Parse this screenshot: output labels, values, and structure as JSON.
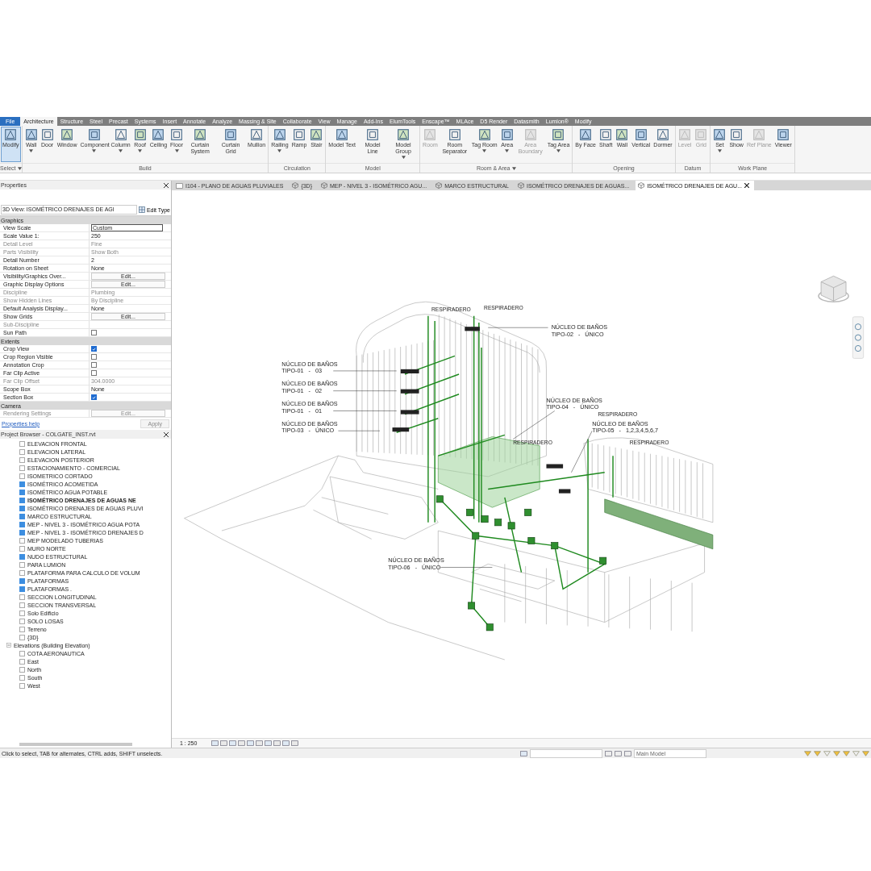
{
  "menu_tabs": [
    {
      "label": "File",
      "kind": "file",
      "selected": false
    },
    {
      "label": "Architecture",
      "kind": "tab",
      "selected": true
    },
    {
      "label": "Structure",
      "kind": "tab",
      "selected": false
    },
    {
      "label": "Steel",
      "kind": "tab",
      "selected": false
    },
    {
      "label": "Precast",
      "kind": "tab",
      "selected": false
    },
    {
      "label": "Systems",
      "kind": "tab",
      "selected": false
    },
    {
      "label": "Insert",
      "kind": "tab",
      "selected": false
    },
    {
      "label": "Annotate",
      "kind": "tab",
      "selected": false
    },
    {
      "label": "Analyze",
      "kind": "tab",
      "selected": false
    },
    {
      "label": "Massing & Site",
      "kind": "tab",
      "selected": false
    },
    {
      "label": "Collaborate",
      "kind": "tab",
      "selected": false
    },
    {
      "label": "View",
      "kind": "tab",
      "selected": false
    },
    {
      "label": "Manage",
      "kind": "tab",
      "selected": false
    },
    {
      "label": "Add-Ins",
      "kind": "tab",
      "selected": false
    },
    {
      "label": "ElumTools",
      "kind": "tab",
      "selected": false
    },
    {
      "label": "Enscape™",
      "kind": "tab",
      "selected": false
    },
    {
      "label": "MLAce",
      "kind": "tab",
      "selected": false
    },
    {
      "label": "D5 Render",
      "kind": "tab",
      "selected": false
    },
    {
      "label": "Datasmith",
      "kind": "tab",
      "selected": false
    },
    {
      "label": "Lumion®",
      "kind": "tab",
      "selected": false
    },
    {
      "label": "Modify",
      "kind": "tab",
      "selected": false
    }
  ],
  "ribbon": {
    "panels": [
      {
        "title": "Select",
        "menu": true,
        "tools": [
          {
            "label": "Modify",
            "active": true,
            "disabled": false,
            "dropdown": false
          }
        ]
      },
      {
        "title": "Build",
        "menu": false,
        "tools": [
          {
            "label": "Wall",
            "active": false,
            "disabled": false,
            "dropdown": true
          },
          {
            "label": "Door",
            "active": false,
            "disabled": false,
            "dropdown": false
          },
          {
            "label": "Window",
            "active": false,
            "disabled": false,
            "dropdown": false
          },
          {
            "label": "Component",
            "active": false,
            "disabled": false,
            "dropdown": true
          },
          {
            "label": "Column",
            "active": false,
            "disabled": false,
            "dropdown": true
          },
          {
            "label": "Roof",
            "active": false,
            "disabled": false,
            "dropdown": true
          },
          {
            "label": "Ceiling",
            "active": false,
            "disabled": false,
            "dropdown": false
          },
          {
            "label": "Floor",
            "active": false,
            "disabled": false,
            "dropdown": true
          },
          {
            "label": "Curtain System",
            "active": false,
            "disabled": false,
            "dropdown": false
          },
          {
            "label": "Curtain Grid",
            "active": false,
            "disabled": false,
            "dropdown": false
          },
          {
            "label": "Mullion",
            "active": false,
            "disabled": false,
            "dropdown": false
          }
        ]
      },
      {
        "title": "Circulation",
        "menu": false,
        "tools": [
          {
            "label": "Railing",
            "active": false,
            "disabled": false,
            "dropdown": true
          },
          {
            "label": "Ramp",
            "active": false,
            "disabled": false,
            "dropdown": false
          },
          {
            "label": "Stair",
            "active": false,
            "disabled": false,
            "dropdown": false
          }
        ]
      },
      {
        "title": "Model",
        "menu": false,
        "tools": [
          {
            "label": "Model Text",
            "active": false,
            "disabled": false,
            "dropdown": false
          },
          {
            "label": "Model Line",
            "active": false,
            "disabled": false,
            "dropdown": false
          },
          {
            "label": "Model Group",
            "active": false,
            "disabled": false,
            "dropdown": true
          }
        ]
      },
      {
        "title": "Room & Area",
        "menu": true,
        "tools": [
          {
            "label": "Room",
            "active": false,
            "disabled": true,
            "dropdown": false
          },
          {
            "label": "Room Separator",
            "active": false,
            "disabled": false,
            "dropdown": false
          },
          {
            "label": "Tag Room",
            "active": false,
            "disabled": false,
            "dropdown": true
          },
          {
            "label": "Area",
            "active": false,
            "disabled": false,
            "dropdown": true
          },
          {
            "label": "Area Boundary",
            "active": false,
            "disabled": true,
            "dropdown": false
          },
          {
            "label": "Tag Area",
            "active": false,
            "disabled": false,
            "dropdown": true
          }
        ]
      },
      {
        "title": "Opening",
        "menu": false,
        "tools": [
          {
            "label": "By Face",
            "active": false,
            "disabled": false,
            "dropdown": false
          },
          {
            "label": "Shaft",
            "active": false,
            "disabled": false,
            "dropdown": false
          },
          {
            "label": "Wall",
            "active": false,
            "disabled": false,
            "dropdown": false
          },
          {
            "label": "Vertical",
            "active": false,
            "disabled": false,
            "dropdown": false
          },
          {
            "label": "Dormer",
            "active": false,
            "disabled": false,
            "dropdown": false
          }
        ]
      },
      {
        "title": "Datum",
        "menu": false,
        "tools": [
          {
            "label": "Level",
            "active": false,
            "disabled": true,
            "dropdown": false
          },
          {
            "label": "Grid",
            "active": false,
            "disabled": true,
            "dropdown": false
          }
        ]
      },
      {
        "title": "Work Plane",
        "menu": false,
        "tools": [
          {
            "label": "Set",
            "active": false,
            "disabled": false,
            "dropdown": true
          },
          {
            "label": "Show",
            "active": false,
            "disabled": false,
            "dropdown": false
          },
          {
            "label": "Ref Plane",
            "active": false,
            "disabled": true,
            "dropdown": false
          },
          {
            "label": "Viewer",
            "active": false,
            "disabled": false,
            "dropdown": false
          }
        ]
      }
    ]
  },
  "properties": {
    "title": "Properties",
    "type_selector": "3D View: ISOMÉTRICO DRENAJES DE AGI",
    "edit_type": "Edit Type",
    "rows": [
      {
        "kind": "section",
        "name": "Graphics"
      },
      {
        "kind": "field",
        "name": "View Scale",
        "value": "Custom",
        "disabled": false
      },
      {
        "kind": "text",
        "name": "Scale Value    1:",
        "value": "250",
        "disabled": false
      },
      {
        "kind": "text",
        "name": "Detail Level",
        "value": "Fine",
        "disabled": true
      },
      {
        "kind": "text",
        "name": "Parts Visibility",
        "value": "Show Both",
        "disabled": true
      },
      {
        "kind": "text",
        "name": "Detail Number",
        "value": "2",
        "disabled": false
      },
      {
        "kind": "text",
        "name": "Rotation on Sheet",
        "value": "None",
        "disabled": false
      },
      {
        "kind": "button",
        "name": "Visibility/Graphics Over...",
        "value": "Edit...",
        "disabled": false
      },
      {
        "kind": "button",
        "name": "Graphic Display Options",
        "value": "Edit...",
        "disabled": false
      },
      {
        "kind": "text",
        "name": "Discipline",
        "value": "Plumbing",
        "disabled": true
      },
      {
        "kind": "text",
        "name": "Show Hidden Lines",
        "value": "By Discipline",
        "disabled": true
      },
      {
        "kind": "text",
        "name": "Default Analysis Display...",
        "value": "None",
        "disabled": false
      },
      {
        "kind": "button",
        "name": "Show Grids",
        "value": "Edit...",
        "disabled": false
      },
      {
        "kind": "text",
        "name": "Sub-Discipline",
        "disabled": true
      },
      {
        "kind": "check",
        "name": "Sun Path",
        "checked": false,
        "disabled": false
      },
      {
        "kind": "section",
        "name": "Extents"
      },
      {
        "kind": "check",
        "name": "Crop View",
        "checked": true,
        "disabled": false
      },
      {
        "kind": "check",
        "name": "Crop Region Visible",
        "checked": false,
        "disabled": false
      },
      {
        "kind": "check",
        "name": "Annotation Crop",
        "checked": false,
        "disabled": false
      },
      {
        "kind": "check",
        "name": "Far Clip Active",
        "checked": false,
        "disabled": false
      },
      {
        "kind": "text",
        "name": "Far Clip Offset",
        "value": "304.0000",
        "disabled": true
      },
      {
        "kind": "text",
        "name": "Scope Box",
        "value": "None",
        "disabled": false
      },
      {
        "kind": "check",
        "name": "Section Box",
        "checked": true,
        "disabled": false
      },
      {
        "kind": "section",
        "name": "Camera"
      },
      {
        "kind": "button",
        "name": "Rendering Settings",
        "value": "Edit...",
        "disabled": true
      }
    ],
    "help_link": "Properties help",
    "apply": {
      "label": "Apply",
      "disabled": true
    }
  },
  "project_browser": {
    "title": "Project Browser - COLGATE_INST.rvt",
    "items": [
      {
        "label": "ELEVACION FRONTAL",
        "marked": false,
        "selected": false
      },
      {
        "label": "ELEVACION LATERAL",
        "marked": false,
        "selected": false
      },
      {
        "label": "ELEVACION POSTERIOR",
        "marked": false,
        "selected": false
      },
      {
        "label": "ESTACIONAMIENTO - COMERCIAL",
        "marked": false,
        "selected": false
      },
      {
        "label": "ISOMETRICO CORTADO",
        "marked": false,
        "selected": false
      },
      {
        "label": "ISOMÉTRICO ACOMETIDA",
        "marked": true,
        "selected": false
      },
      {
        "label": "ISOMÉTRICO AGUA POTABLE",
        "marked": true,
        "selected": false
      },
      {
        "label": "ISOMÉTRICO DRENAJES DE AGUAS NE",
        "marked": true,
        "selected": true
      },
      {
        "label": "ISOMÉTRICO DRENAJES DE AGUAS PLUVI",
        "marked": true,
        "selected": false
      },
      {
        "label": "MARCO ESTRUCTURAL",
        "marked": true,
        "selected": false
      },
      {
        "label": "MEP - NIVEL 3 - ISOMÉTRICO AGUA POTA",
        "marked": true,
        "selected": false
      },
      {
        "label": "MEP - NIVEL 3 - ISOMÉTRICO DRENAJES D",
        "marked": true,
        "selected": false
      },
      {
        "label": "MEP MODELADO TUBERIAS",
        "marked": false,
        "selected": false
      },
      {
        "label": "MURO NORTE",
        "marked": false,
        "selected": false
      },
      {
        "label": "NUDO ESTRUCTURAL",
        "marked": true,
        "selected": false
      },
      {
        "label": "PARA LUMION",
        "marked": false,
        "selected": false
      },
      {
        "label": "PLATAFORMA PARA CALCULO DE VOLUM",
        "marked": false,
        "selected": false
      },
      {
        "label": "PLATAFORMAS",
        "marked": true,
        "selected": false
      },
      {
        "label": "PLATAFORMAS .",
        "marked": true,
        "selected": false
      },
      {
        "label": "SECCION LONGITUDINAL",
        "marked": false,
        "selected": false
      },
      {
        "label": "SECCION TRANSVERSAL",
        "marked": false,
        "selected": false
      },
      {
        "label": "Solo Edificio",
        "marked": false,
        "selected": false
      },
      {
        "label": "SOLO LOSAS",
        "marked": false,
        "selected": false
      },
      {
        "label": "Terreno",
        "marked": false,
        "selected": false
      },
      {
        "label": "{3D}",
        "marked": false,
        "selected": false
      }
    ],
    "groups": [
      {
        "label": "Elevations (Building Elevation)",
        "expanded": true,
        "children": [
          {
            "label": "COTA AERONAUTICA",
            "marked": false,
            "selected": false
          },
          {
            "label": "East",
            "marked": false,
            "selected": false
          },
          {
            "label": "North",
            "marked": false,
            "selected": false
          },
          {
            "label": "South",
            "marked": false,
            "selected": false
          },
          {
            "label": "West",
            "marked": false,
            "selected": false
          }
        ]
      }
    ]
  },
  "view_tabs": [
    {
      "label": "I104 - PLANO DE AGUAS PLUVIALES",
      "kind": "sheet",
      "selected": false
    },
    {
      "label": "{3D}",
      "kind": "view3d",
      "selected": false
    },
    {
      "label": "MEP - NIVEL 3 - ISOMÉTRICO AGU...",
      "kind": "view3d",
      "selected": false
    },
    {
      "label": "MARCO ESTRUCTURAL",
      "kind": "view3d",
      "selected": false
    },
    {
      "label": "ISOMÉTRICO DRENAJES DE AGUAS...",
      "kind": "view3d",
      "selected": false
    },
    {
      "label": "ISOMÉTRICO DRENAJES DE AGU...",
      "kind": "view3d",
      "selected": true
    }
  ],
  "drawing": {
    "annotations": [
      {
        "title": "NÚCLEO DE BAÑOS",
        "subtitle": "TIPO-02   -   ÚNICO"
      },
      {
        "title": "NÚCLEO DE BAÑOS",
        "subtitle": "TIPO-01   -   03"
      },
      {
        "title": "NÚCLEO DE BAÑOS",
        "subtitle": "TIPO-01   -   02"
      },
      {
        "title": "NÚCLEO DE BAÑOS",
        "subtitle": "TIPO-01   -   01"
      },
      {
        "title": "NÚCLEO DE BAÑOS",
        "subtitle": "TIPO-03   -   ÚNICO"
      },
      {
        "title": "NÚCLEO DE BAÑOS",
        "subtitle": "TIPO-04   -   ÚNICO"
      },
      {
        "title": "NÚCLEO DE BAÑOS",
        "subtitle": "TIPO-05   -   1,2,3,4,5,6,7"
      },
      {
        "title": "NÚCLEO DE BAÑOS",
        "subtitle": "TIPO-06   -   ÚNICO"
      }
    ],
    "vent_labels": [
      "RESPIRADERO",
      "RESPIRADERO",
      "RESPIRADERO",
      "RESPIRADERO",
      "RESPIRADERO"
    ]
  },
  "view_control": {
    "scale": "1 : 250"
  },
  "status_bar": {
    "message": "Click to select, TAB for alternates, CTRL adds, SHIFT unselects.",
    "model": "Main Model"
  }
}
